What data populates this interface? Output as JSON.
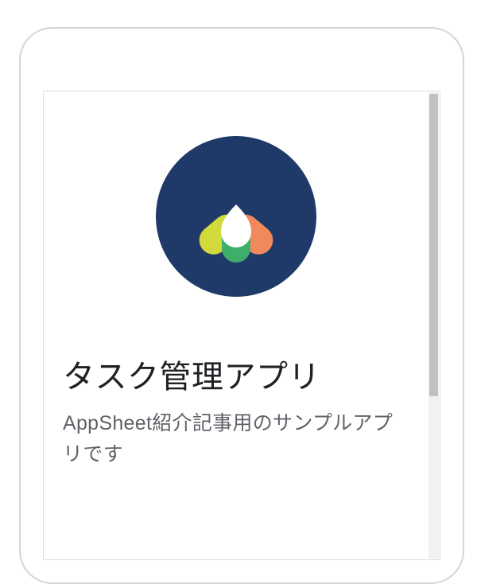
{
  "app": {
    "title": "タスク管理アプリ",
    "description": "AppSheet紹介記事用のサンプルアプリです"
  },
  "logo": {
    "bg_color": "#1f3a68",
    "lobe_yellow": "#d2d93b",
    "lobe_orange": "#f08a5d",
    "lobe_green": "#3fae6a",
    "center_white": "#ffffff"
  }
}
